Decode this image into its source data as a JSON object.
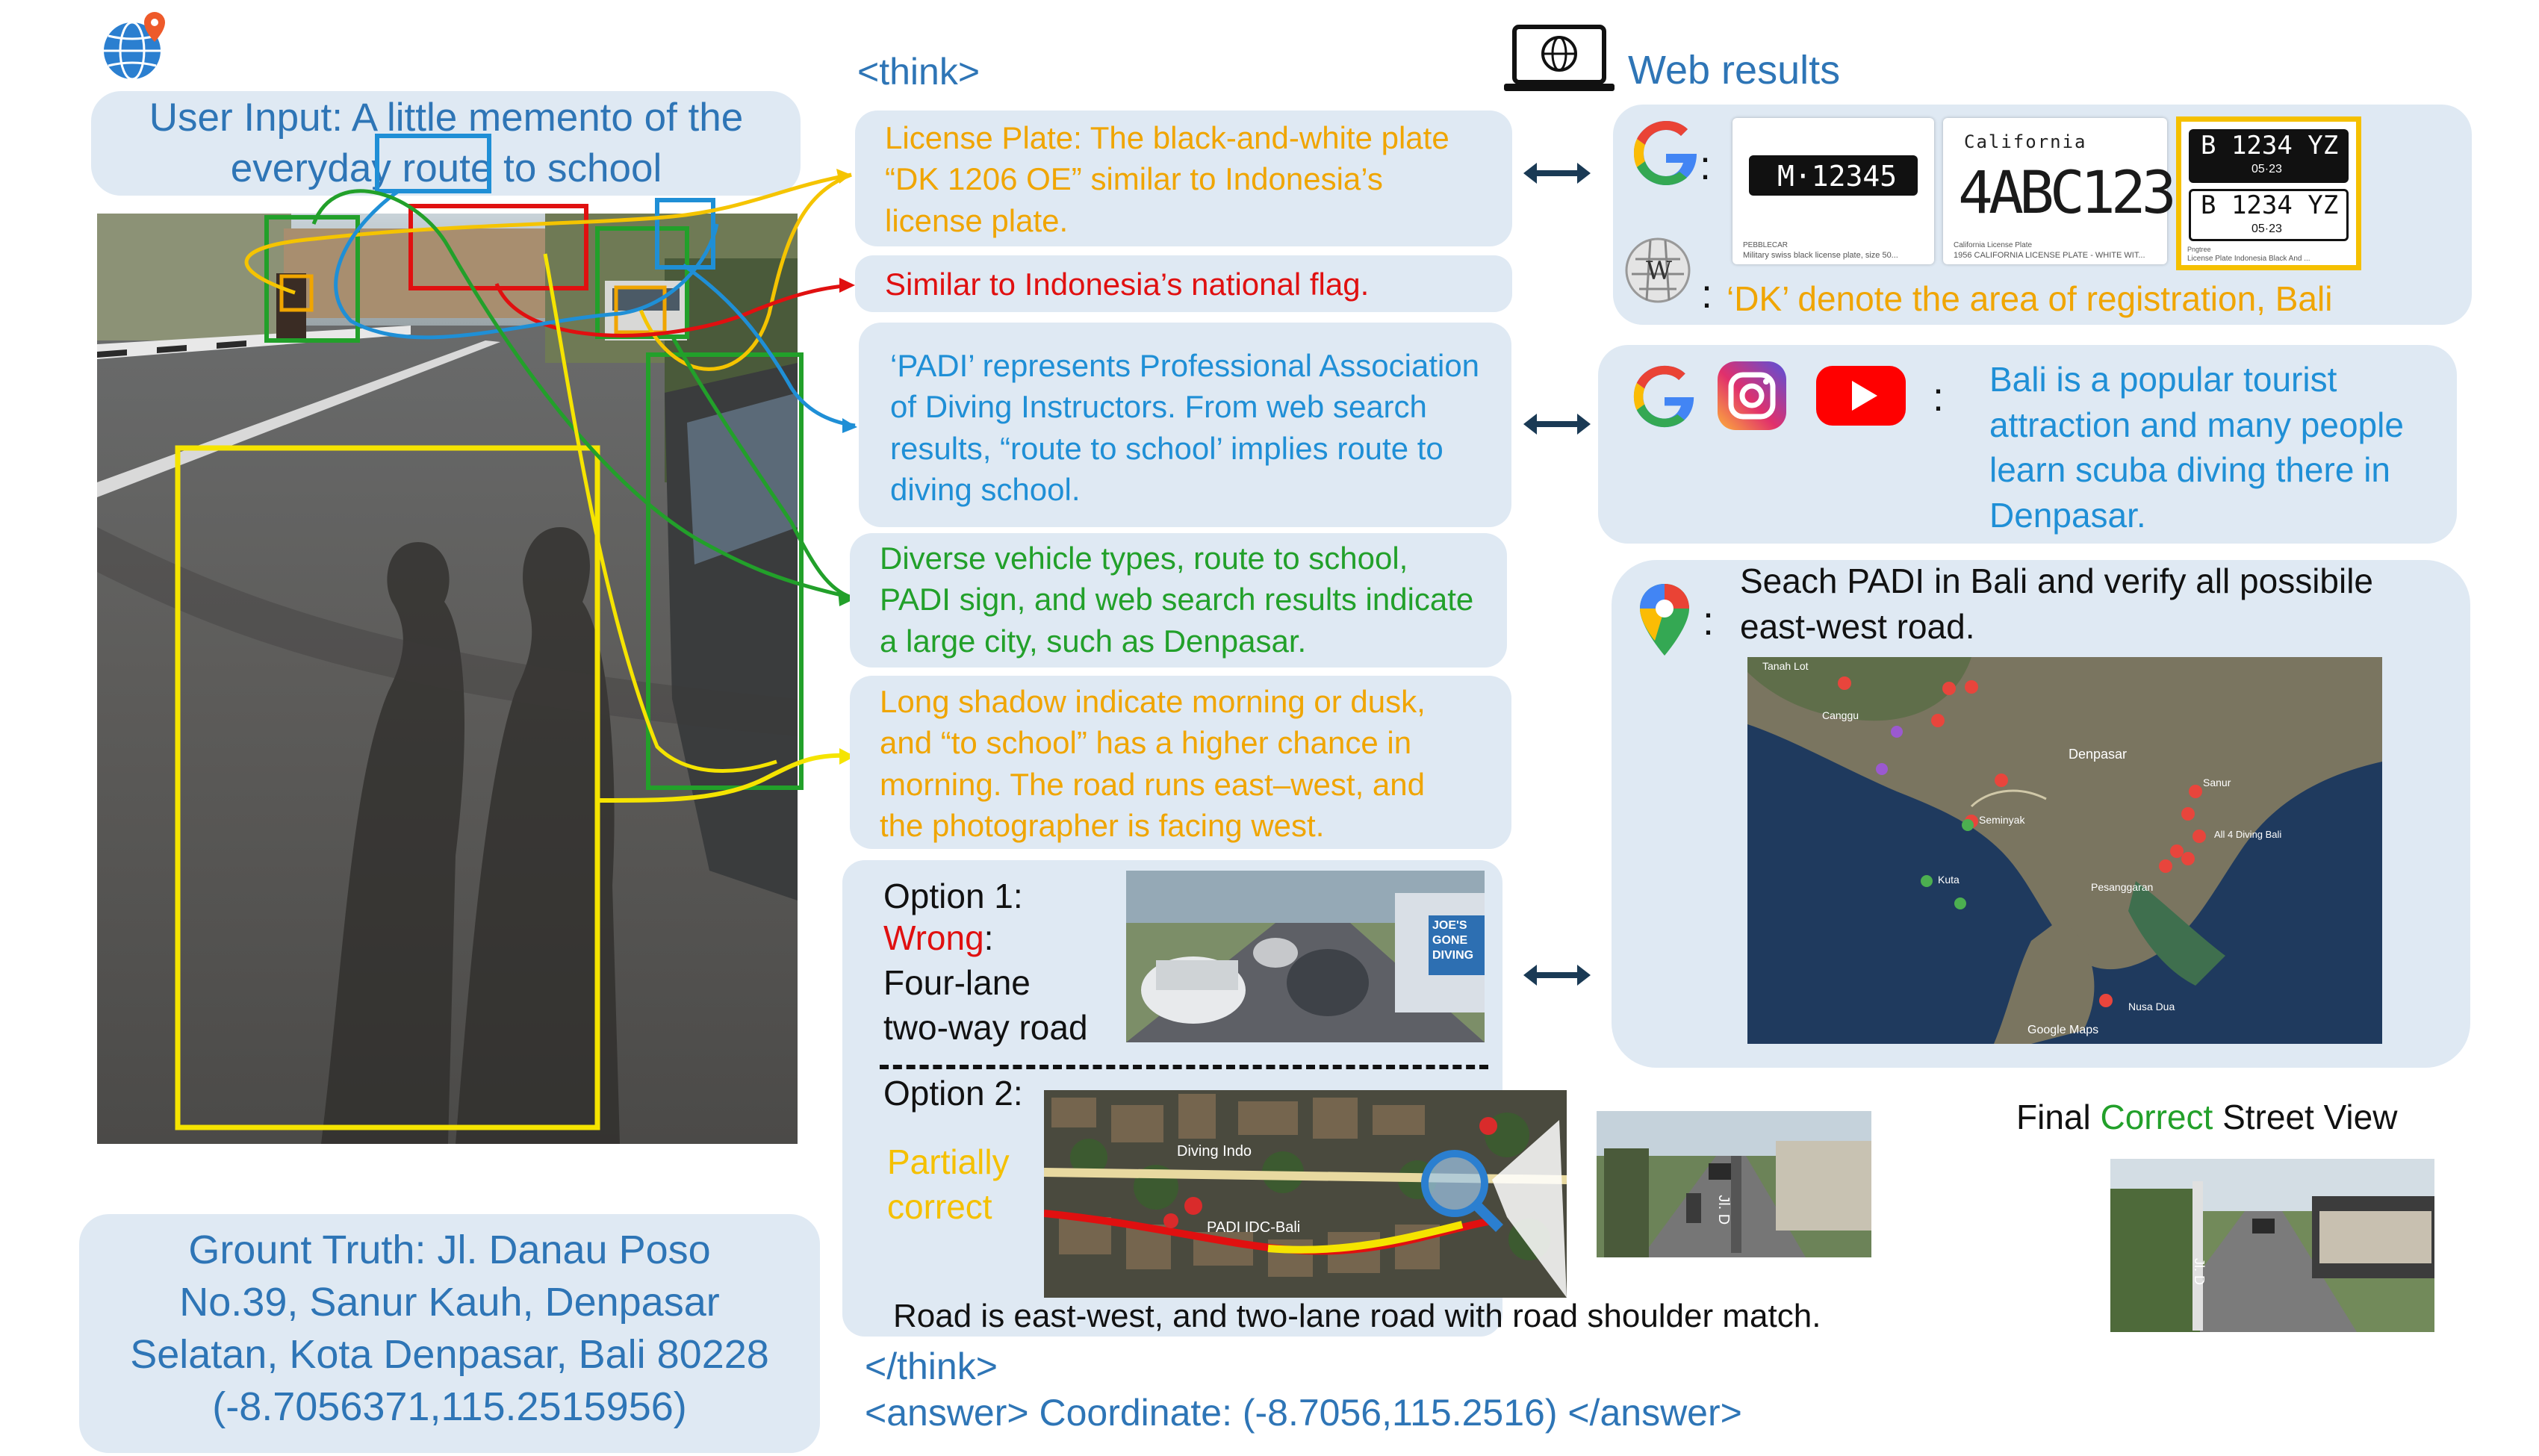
{
  "user_input": "User Input: A little memento of the everyday route to school",
  "ground_truth": [
    "Grount Truth: Jl. Danau Poso",
    "No.39, Sanur Kauh, Denpasar",
    "Selatan, Kota Denpasar, Bali 80228",
    "(-8.7056371,115.2515956)"
  ],
  "think_open": "<think>",
  "think_close": "</think>",
  "answer": "<answer> Coordinate: (-8.7056,115.2516) </answer>",
  "web_results_title": "Web results",
  "reasoning": {
    "license_plate": "License Plate: The black-and-white plate “DK 1206 OE” similar to Indonesia’s license plate.",
    "flag": "Similar to Indonesia’s national flag.",
    "padi": "‘PADI’ represents Professional Association of Diving Instructors. From web search results, “route to school’ implies route to diving school.",
    "vehicles": "Diverse vehicle types, route to school, PADI sign, and web search results indicate a large city, such as Denpasar.",
    "shadow": "Long shadow indicate morning or dusk, and “to school” has a higher chance in morning. The road runs east–west, and the photographer is facing west."
  },
  "web": {
    "plates": [
      {
        "text": "M·12345",
        "caption": "Military swiss black license plate, size 50..."
      },
      {
        "text": "4ABC123",
        "top": "California",
        "caption": "1956 CALIFORNIA LICENSE PLATE - WHITE WIT..."
      },
      {
        "line1": "B 1234 YZ",
        "line2": "05·23",
        "caption": "License Plate Indonesia Black And ..."
      }
    ],
    "plate_source_1": "PEBBLECAR",
    "plate_source_2": "California License Plate",
    "plate_source_3": "Pngtree",
    "wiki_result": "‘DK’ denote the area of registration, Bali",
    "social_result": "Bali is a popular tourist attraction and many people learn scuba diving there in Denpasar.",
    "maps_query": "Seach PADI in Bali and verify all possibile east-west road.",
    "colon": ":"
  },
  "options": {
    "option1_title": "Option 1:",
    "option1_verdict": "Wrong",
    "option1_desc": [
      "Four-lane",
      "two-way road"
    ],
    "option2_title": "Option 2:",
    "option2_verdict": [
      "Partially",
      "correct"
    ],
    "road_match": "Road is east-west, and two-lane road with road shoulder match.",
    "final_prefix": "Final ",
    "final_correct": "Correct",
    "final_suffix": " Street View"
  },
  "map_labels": [
    "Tanah Lot",
    "Canggu",
    "Seminyak",
    "Denpasar",
    "Kuta",
    "Sanur",
    "Nusa Dua",
    "Google Maps",
    "Pesanggaran",
    "All 4 Diving Bali",
    "PADI IDC-Bali",
    "Diving Indo"
  ],
  "sign_text": [
    "JOE'S",
    "GONE",
    "DIVING"
  ],
  "street_sign": "Jl. D",
  "colors": {
    "panel": "#dfe9f3",
    "yellow": "#f5e400",
    "orange": "#f0a500",
    "red": "#e01010",
    "green": "#22a02a",
    "cyan": "#1f8fd6",
    "dark_blue": "#1a4f86"
  }
}
